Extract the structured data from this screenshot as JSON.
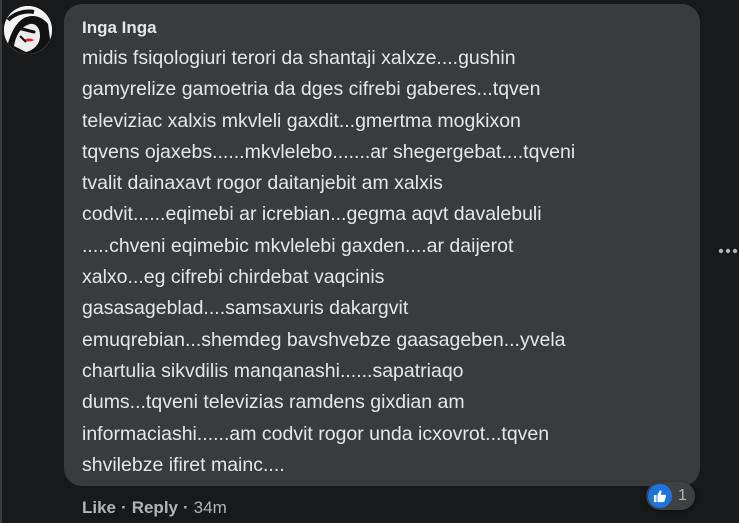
{
  "comment": {
    "author": "Inga Inga",
    "text": "midis fsiqologiuri terori da shantaji xalxze....gushin\ngamyrelize gamoetria da dges cifrebi gaberes...tqven\nteleviziac xalxis mkvleli gaxdit...gmertma mogkixon\ntqvens ojaxebs......mkvlelebo.......ar shegergebat....tqveni\ntvalit dainaxavt rogor daitanjebit am xalxis\ncodvit......eqimebi ar icrebian...gegma aqvt davalebuli\n.....chveni eqimebic mkvlelebi gaxden....ar daijerot\nxalxo...eg cifrebi chirdebat vaqcinis\ngasasageblad....samsaxuris dakargvit\nemuqrebian...shemdeg bavshvebze gaasageben...yvela\nchartulia sikvdilis manqanashi......sapatriaqo\ndums...tqveni televizias ramdens gixdian am\ninformaciashi......am codvit rogor unda icxovrot...tqven\nshvilebze ifiret mainc...."
  },
  "actions": {
    "like_label": "Like",
    "separator": "·",
    "reply_label": "Reply",
    "timestamp": "34m"
  },
  "reactions": {
    "count": "1",
    "icon": "thumbs-up-icon",
    "color": "#1b74e4"
  },
  "colors": {
    "background": "#18191a",
    "bubble": "#3a3b3c",
    "text": "#e4e6eb",
    "secondary_text": "#b0b3b8"
  }
}
